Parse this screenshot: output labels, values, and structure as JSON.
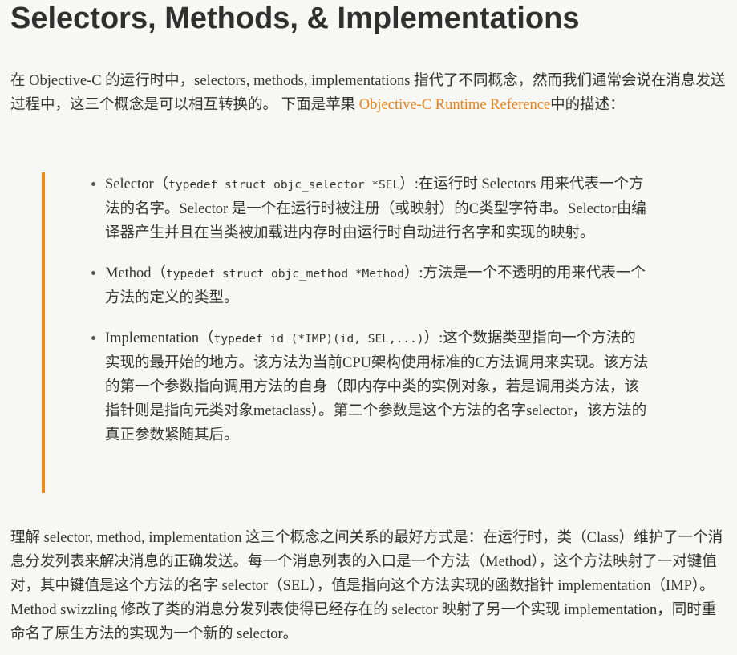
{
  "title": "Selectors, Methods, & Implementations",
  "intro": {
    "text_before_link": "在 Objective-C 的运行时中，selectors, methods, implementations 指代了不同概念，然而我们通常会说在消息发送过程中，这三个概念是可以相互转换的。 下面是苹果 ",
    "link_text": "Objective-C Runtime Reference",
    "text_after_link": "中的描述："
  },
  "definitions": [
    {
      "name": "Selector",
      "open_paren": "（",
      "code": "typedef struct objc_selector *SEL",
      "close_paren": "）",
      "description": ":在运行时 Selectors 用来代表一个方法的名字。Selector 是一个在运行时被注册（或映射）的C类型字符串。Selector由编译器产生并且在当类被加载进内存时由运行时自动进行名字和实现的映射。"
    },
    {
      "name": "Method",
      "open_paren": "（",
      "code": "typedef struct objc_method *Method",
      "close_paren": "）",
      "description": ":方法是一个不透明的用来代表一个方法的定义的类型。"
    },
    {
      "name": "Implementation",
      "open_paren": "（",
      "code": "typedef id (*IMP)(id, SEL,...)",
      "close_paren": "）",
      "description": ":这个数据类型指向一个方法的实现的最开始的地方。该方法为当前CPU架构使用标准的C方法调用来实现。该方法的第一个参数指向调用方法的自身（即内存中类的实例对象，若是调用类方法，该指针则是指向元类对象metaclass）。第二个参数是这个方法的名字selector，该方法的真正参数紧随其后。"
    }
  ],
  "outro": "理解 selector, method, implementation 这三个概念之间关系的最好方式是：在运行时，类（Class）维护了一个消息分发列表来解决消息的正确发送。每一个消息列表的入口是一个方法（Method），这个方法映射了一对键值对，其中键值是这个方法的名字 selector（SEL），值是指向这个方法实现的函数指针 implementation（IMP）。 Method swizzling 修改了类的消息分发列表使得已经存在的 selector 映射了另一个实现 implementation，同时重命名了原生方法的实现为一个新的 selector。",
  "colors": {
    "link": "#e8821a",
    "quote_bar": "#f08a15",
    "text": "#333333",
    "background": "#f7f7f5"
  }
}
